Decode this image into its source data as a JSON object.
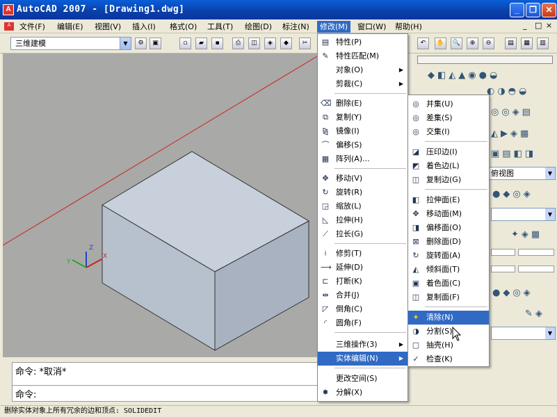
{
  "window": {
    "title": "AutoCAD 2007 - [Drawing1.dwg]",
    "app_icon": "A"
  },
  "menubar": {
    "items": [
      "文件(F)",
      "编辑(E)",
      "视图(V)",
      "插入(I)",
      "格式(O)",
      "工具(T)",
      "绘图(D)",
      "标注(N)",
      "修改(M)",
      "窗口(W)",
      "帮助(H)"
    ],
    "active_index": 8
  },
  "toolbar": {
    "workspace": "三维建模"
  },
  "modify_menu": {
    "group1": [
      "特性(P)",
      "特性匹配(M)",
      "对象(O)",
      "剪裁(C)"
    ],
    "group2": [
      "删除(E)",
      "复制(Y)",
      "镜像(I)",
      "偏移(S)",
      "阵列(A)..."
    ],
    "group3": [
      "移动(V)",
      "旋转(R)",
      "缩放(L)",
      "拉伸(H)",
      "拉长(G)"
    ],
    "group4": [
      "修剪(T)",
      "延伸(D)",
      "打断(K)",
      "合并(J)",
      "倒角(C)",
      "圆角(F)"
    ],
    "group5": [
      "三维操作(3)",
      "实体编辑(N)"
    ],
    "group6": [
      "更改空间(S)",
      "分解(X)"
    ]
  },
  "solid_edit_menu": {
    "group1": [
      "并集(U)",
      "差集(S)",
      "交集(I)"
    ],
    "group2": [
      "压印边(I)",
      "着色边(L)",
      "复制边(G)"
    ],
    "group3": [
      "拉伸面(E)",
      "移动面(M)",
      "偏移面(O)",
      "删除面(D)",
      "旋转面(A)",
      "倾斜面(T)",
      "着色面(C)",
      "复制面(F)"
    ],
    "group4": [
      "清除(N)",
      "分割(S)",
      "抽壳(H)",
      "检查(K)"
    ],
    "highlight": "清除(N)"
  },
  "right_panel": {
    "view_label": "俯视图"
  },
  "command": {
    "line1": "命令: *取消*",
    "line2": "命令:"
  },
  "status": {
    "text": "删除实体对象上所有冗余的边和顶点:  SOLIDEDIT"
  },
  "colors": {
    "accent": "#316ac5",
    "canvas": "#a9a9a7",
    "box_top": "#c8d0dc",
    "box_left": "#b7c0cd",
    "box_right": "#a8b2c0",
    "axis_red": "#cc2222"
  }
}
